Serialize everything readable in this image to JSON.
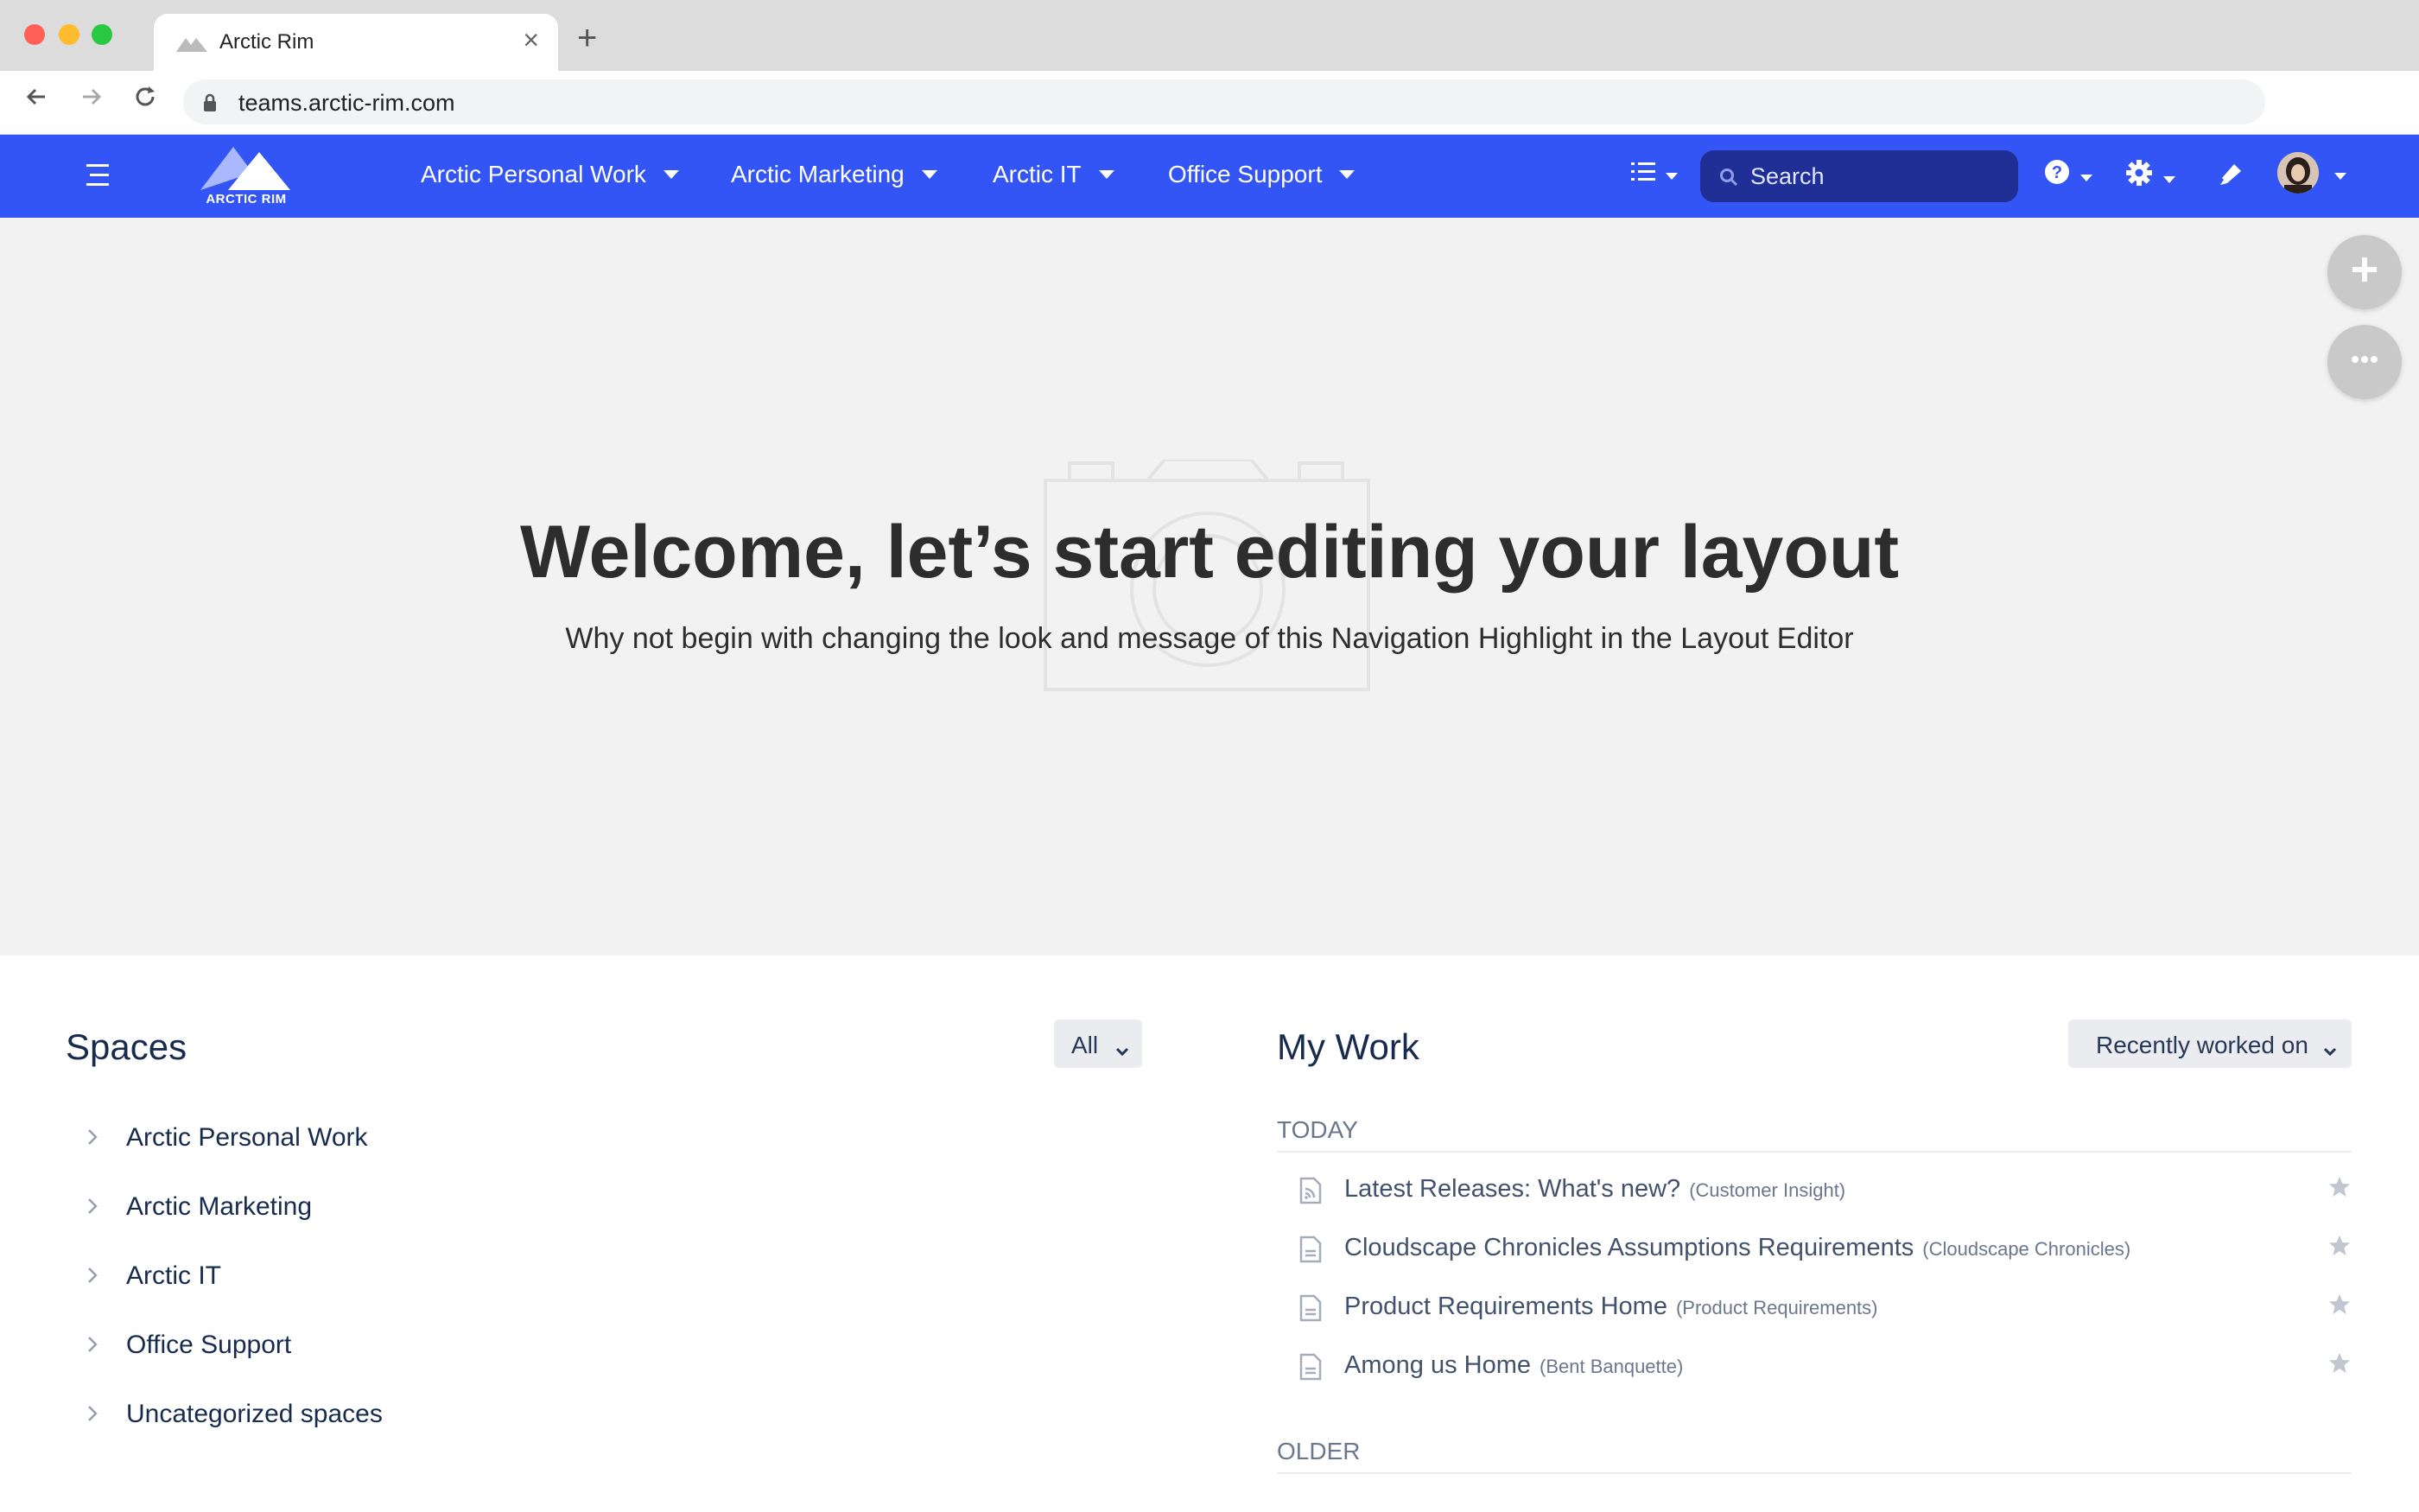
{
  "browser": {
    "tab_title": "Arctic Rim",
    "url": "teams.arctic-rim.com"
  },
  "appnav": {
    "logo_text": "ARCTIC RIM",
    "menus": [
      {
        "label": "Arctic Personal Work"
      },
      {
        "label": "Arctic Marketing"
      },
      {
        "label": "Arctic IT"
      },
      {
        "label": "Office Support"
      }
    ],
    "search_placeholder": "Search"
  },
  "hero": {
    "title": "Welcome, let’s start editing your layout",
    "subtitle": "Why not begin with changing the look and message of this Navigation Highlight in the Layout Editor"
  },
  "spaces": {
    "title": "Spaces",
    "filter_label": "All",
    "items": [
      {
        "label": "Arctic Personal Work"
      },
      {
        "label": "Arctic Marketing"
      },
      {
        "label": "Arctic IT"
      },
      {
        "label": "Office Support"
      },
      {
        "label": "Uncategorized spaces"
      }
    ]
  },
  "my_work": {
    "title": "My Work",
    "filter_label": "Recently worked on",
    "today_label": "TODAY",
    "older_label": "OLDER",
    "items": [
      {
        "title": "Latest Releases: What's new?",
        "space": "(Customer Insight)",
        "icon": "blog-icon"
      },
      {
        "title": "Cloudscape Chronicles Assumptions Requirements",
        "space": "(Cloudscape Chronicles)",
        "icon": "page-icon"
      },
      {
        "title": "Product Requirements Home",
        "space": "(Product Requirements)",
        "icon": "page-icon"
      },
      {
        "title": "Among us Home",
        "space": "(Bent Banquette)",
        "icon": "page-icon"
      }
    ]
  },
  "colors": {
    "nav_bg": "#3355f5",
    "search_bg": "#1f2f95",
    "hero_bg": "#f2f2f2"
  }
}
